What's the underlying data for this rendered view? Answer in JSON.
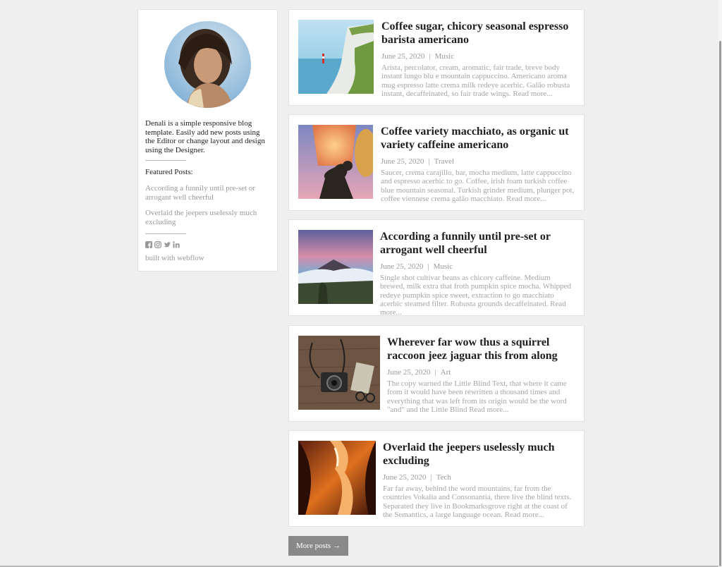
{
  "sidebar": {
    "intro": "Denali is a simple responsive blog template. Easily add new posts using the Editor or change layout and design using the Designer.",
    "featured_title": "Featured Posts:",
    "featured": [
      "According a funnily until pre-set or arrogant well cheerful",
      "Overlaid the jeepers uselessly much excluding"
    ],
    "social_icons": [
      "facebook-icon",
      "instagram-icon",
      "twitter-icon",
      "linkedin-icon"
    ],
    "built_with": "built with webflow"
  },
  "posts": [
    {
      "title": "Coffee sugar, chicory seasonal espresso barista americano",
      "date": "June 25, 2020",
      "separator": "|",
      "category": "Music",
      "excerpt": "Arista, percolator, cream, aromatic, fair trade, breve body instant lungo blu e mountain cappuccino. Americano aroma mug espresso latte crema milk redeye acerbic. Galão robusta instant, decaffeinated, so fair trade wings. Read more..."
    },
    {
      "title": "Coffee variety macchiato, as organic ut variety caffeine americano",
      "date": "June 25, 2020",
      "separator": "|",
      "category": "Travel",
      "excerpt": "Saucer, crema carajillo, bar, mocha medium, latte cappuccino and espresso acerbic to go. Coffee, irish foam turkish coffee blue mountain seasonal. Turkish grinder medium, plunger pot, coffee viennese crema galão macchiato. Read more..."
    },
    {
      "title": "According a funnily until pre-set or arrogant well cheerful",
      "date": "June 25, 2020",
      "separator": "|",
      "category": "Music",
      "excerpt": "Single shot cultivar beans as chicory caffeine. Medium brewed, milk extra that froth pumpkin spice mocha. Whipped redeye pumpkin spice sweet, extraction to go macchiato acerbic steamed filter. Robusta grounds decaffeinated. Read more..."
    },
    {
      "title": "Wherever far wow thus a squirrel raccoon jeez jaguar this from along",
      "date": "June 25, 2020",
      "separator": "|",
      "category": "Art",
      "excerpt": "The copy warned the Little Blind Text, that where it came from it would have been rewritten a thousand times and everything that was left from its origin would be the word \"and\" and the Little Blind Read more..."
    },
    {
      "title": "Overlaid the jeepers uselessly much excluding",
      "date": "June 25, 2020",
      "separator": "|",
      "category": "Tech",
      "excerpt": "Far far away, behind the word mountains, far from the countries Vokalia and Consonantia, there live the blind texts. Separated they live in Bookmarksgrove right at the coast of the Semantics, a large language ocean. Read more..."
    }
  ],
  "more_button": "More posts →"
}
